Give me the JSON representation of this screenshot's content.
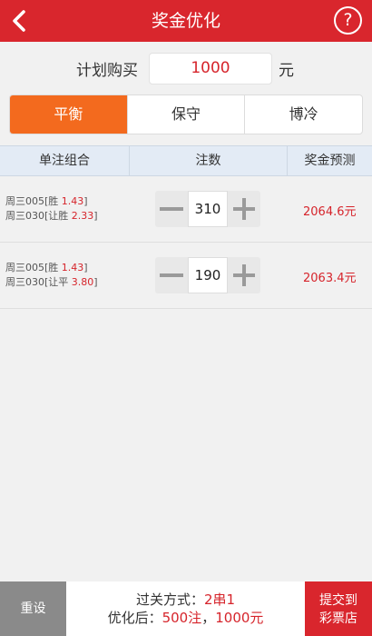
{
  "header": {
    "title": "奖金优化",
    "help_label": "?"
  },
  "plan": {
    "label": "计划购买",
    "amount": "1000",
    "unit": "元"
  },
  "tabs": [
    {
      "label": "平衡",
      "active": true
    },
    {
      "label": "保守",
      "active": false
    },
    {
      "label": "博冷",
      "active": false
    }
  ],
  "table": {
    "headers": [
      "单注组合",
      "注数",
      "奖金预测"
    ],
    "rows": [
      {
        "line1_prefix": "周三005[胜 ",
        "line1_odd": "1.43",
        "line1_suffix": "]",
        "line2_prefix": "周三030[让胜 ",
        "line2_odd": "2.33",
        "line2_suffix": "]",
        "count": "310",
        "prize": "2064.6元"
      },
      {
        "line1_prefix": "周三005[胜 ",
        "line1_odd": "1.43",
        "line1_suffix": "]",
        "line2_prefix": "周三030[让平 ",
        "line2_odd": "3.80",
        "line2_suffix": "]",
        "count": "190",
        "prize": "2063.4元"
      }
    ]
  },
  "footer": {
    "reset_label": "重设",
    "pass_prefix": "过关方式：",
    "pass_value": "2串1",
    "opt_prefix": "优化后：",
    "opt_count": "500注",
    "opt_sep": "，",
    "opt_amount": "1000元",
    "submit_line1": "提交到",
    "submit_line2": "彩票店"
  },
  "colors": {
    "brand": "#d9262d",
    "active_tab": "#f36a1e",
    "odds": "#d6242b"
  },
  "icons": {
    "back": "chevron-left-icon",
    "help": "question-circle-icon",
    "minus": "minus-icon",
    "plus": "plus-icon"
  }
}
